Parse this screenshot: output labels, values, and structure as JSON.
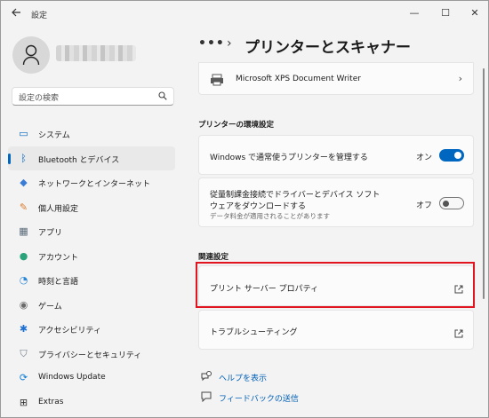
{
  "window": {
    "app_title": "設定",
    "controls": {
      "minimize": "—",
      "maximize": "☐",
      "close": "✕"
    }
  },
  "account": {
    "name": ""
  },
  "search": {
    "placeholder": "設定の検索"
  },
  "sidebar": {
    "items": [
      {
        "label": "システム",
        "icon": "system-icon",
        "color": "#0067c0",
        "selected": false
      },
      {
        "label": "Bluetooth とデバイス",
        "icon": "bluetooth-icon",
        "color": "#0067c0",
        "selected": true
      },
      {
        "label": "ネットワークとインターネット",
        "icon": "wifi-icon",
        "color": "#3a7bd5",
        "selected": false
      },
      {
        "label": "個人用設定",
        "icon": "brush-icon",
        "color": "#d97a2b",
        "selected": false
      },
      {
        "label": "アプリ",
        "icon": "apps-icon",
        "color": "#5a6b7a",
        "selected": false
      },
      {
        "label": "アカウント",
        "icon": "account-icon",
        "color": "#2aa37a",
        "selected": false
      },
      {
        "label": "時刻と言語",
        "icon": "globe-clock-icon",
        "color": "#2b88d8",
        "selected": false
      },
      {
        "label": "ゲーム",
        "icon": "gamepad-icon",
        "color": "#6b6b6b",
        "selected": false
      },
      {
        "label": "アクセシビリティ",
        "icon": "accessibility-icon",
        "color": "#1d6fd1",
        "selected": false
      },
      {
        "label": "プライバシーとセキュリティ",
        "icon": "shield-icon",
        "color": "#6b7785",
        "selected": false
      },
      {
        "label": "Windows Update",
        "icon": "update-icon",
        "color": "#0a7cd6",
        "selected": false
      },
      {
        "label": "Extras",
        "icon": "extras-icon",
        "color": "#333333",
        "selected": false
      }
    ]
  },
  "breadcrumb": {
    "more": "•••",
    "separator": "›",
    "title": "プリンターとスキャナー"
  },
  "printer": {
    "name": "Microsoft XPS Document Writer"
  },
  "preferences": {
    "heading": "プリンターの環境設定",
    "default_printer": {
      "label": "Windows で通常使うプリンターを管理する",
      "state": "オン",
      "on": true
    },
    "metered": {
      "label_line1": "従量制課金接続でドライバーとデバイス ソフト",
      "label_line2": "ウェアをダウンロードする",
      "sub": "データ料金が適用されることがあります",
      "state": "オフ",
      "on": false
    }
  },
  "related": {
    "heading": "関連設定",
    "items": [
      {
        "label": "プリント サーバー プロパティ"
      },
      {
        "label": "トラブルシューティング"
      }
    ]
  },
  "footer": {
    "help": "ヘルプを表示",
    "feedback": "フィードバックの送信"
  },
  "colors": {
    "accent": "#0067c0",
    "highlight": "#e0151f",
    "link": "#0060b8"
  }
}
